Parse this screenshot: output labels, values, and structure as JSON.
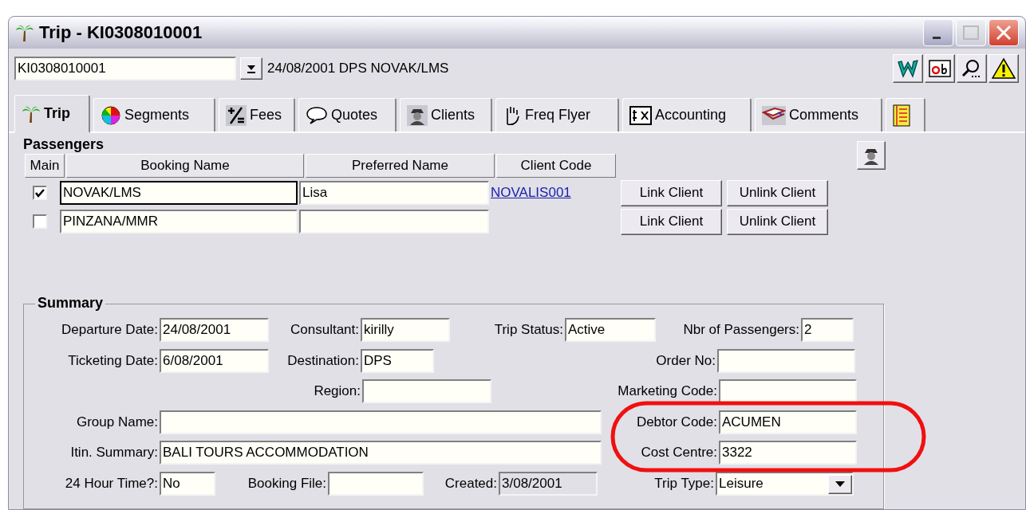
{
  "window": {
    "title": "Trip - KI0308010001"
  },
  "trip_selector": {
    "value": "KI0308010001",
    "summary": "24/08/2001 DPS NOVAK/LMS"
  },
  "tabs": [
    {
      "label": "Trip",
      "selected": true
    },
    {
      "label": "Segments",
      "selected": false
    },
    {
      "label": "Fees",
      "selected": false
    },
    {
      "label": "Quotes",
      "selected": false
    },
    {
      "label": "Clients",
      "selected": false
    },
    {
      "label": "Freq Flyer",
      "selected": false
    },
    {
      "label": "Accounting",
      "selected": false
    },
    {
      "label": "Comments",
      "selected": false
    },
    {
      "selected": false
    }
  ],
  "passengers": {
    "title": "Passengers",
    "columns": [
      "Main",
      "Booking Name",
      "Preferred Name",
      "Client Code"
    ],
    "rows": [
      {
        "main": true,
        "focused": true,
        "booking_name": "NOVAK/LMS",
        "preferred_name": "Lisa",
        "client_code": "NOVALIS001",
        "buttons": [
          "Link Client",
          "Unlink Client"
        ]
      },
      {
        "main": false,
        "focused": false,
        "booking_name": "PINZANA/MMR",
        "buttons": [
          "Link Client",
          "Unlink Client"
        ]
      }
    ]
  },
  "summary": {
    "title": "Summary",
    "rows": [
      [
        {
          "label": "Departure Date:",
          "value": "24/08/2001"
        },
        {
          "label": "Consultant:",
          "value": "kirilly"
        },
        {
          "label": "Trip Status:",
          "value": "Active"
        },
        {
          "label": "Nbr of Passengers:",
          "value": "2"
        }
      ],
      [
        {
          "label": "Ticketing Date:",
          "value": "6/08/2001"
        },
        {
          "label": "Destination:",
          "value": "DPS"
        },
        "",
        {
          "label": "Order No:"
        }
      ],
      [
        "",
        {
          "label": "Region:"
        },
        "",
        {
          "label": "Marketing Code:"
        }
      ],
      [
        {
          "label": "Group Name:"
        },
        "",
        "",
        {
          "label": "Debtor Code:",
          "value": "ACUMEN"
        }
      ],
      [
        {
          "label": "Itin. Summary:",
          "value": "BALI TOURS ACCOMMODATION"
        },
        "",
        "",
        {
          "label": "Cost Centre:",
          "value": "3322"
        }
      ],
      [
        {
          "label": "24 Hour Time?:",
          "value": "No"
        },
        {
          "label": "Booking File:"
        },
        {
          "label": "Created:",
          "value": "3/08/2001",
          "disabled": true
        },
        {
          "label": "Trip Type:",
          "value": "Leisure",
          "kind": "dropdown"
        }
      ]
    ]
  }
}
